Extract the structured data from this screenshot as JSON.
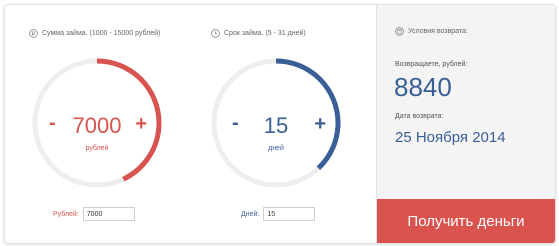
{
  "colors": {
    "red": "#d9534f",
    "blue": "#3a5f96",
    "track": "#eeeeee"
  },
  "amount": {
    "header": "Сумма займа. (1000 - 15000 рублей)",
    "icon": "ruble-icon",
    "value": "7000",
    "unit": "рублей",
    "minus": "-",
    "plus": "+",
    "field_label": "Рублей:",
    "field_value": "7000",
    "fraction": 0.43
  },
  "term": {
    "header": "Срок займа. (5 - 31 дней)",
    "icon": "clock-icon",
    "value": "15",
    "unit": "дней",
    "minus": "-",
    "plus": "+",
    "field_label": "Дней:",
    "field_value": "15",
    "fraction": 0.38
  },
  "summary": {
    "header": "Условия возврата:",
    "icon": "calculator-icon",
    "return_label": "Возвращаете, рублей:",
    "return_value": "8840",
    "date_label": "Дата возврата:",
    "date_value": "25 Ноября 2014",
    "button": "Получить деньги"
  }
}
